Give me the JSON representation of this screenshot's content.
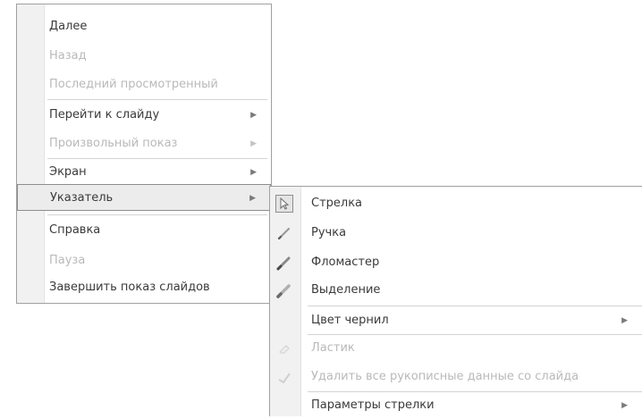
{
  "main_menu": {
    "items": [
      {
        "label": "Далее",
        "disabled": false
      },
      {
        "label": "Назад",
        "disabled": true
      },
      {
        "label": "Последний просмотренный",
        "disabled": true
      },
      {
        "label": "Перейти к слайду",
        "disabled": false,
        "submenu": true
      },
      {
        "label": "Произвольный показ",
        "disabled": true,
        "submenu": true
      },
      {
        "label": "Экран",
        "disabled": false,
        "submenu": true
      },
      {
        "label": "Указатель",
        "disabled": false,
        "submenu": true,
        "highlighted": true
      },
      {
        "label": "Справка",
        "disabled": false
      },
      {
        "label": "Пауза",
        "disabled": true
      },
      {
        "label": "Завершить показ слайдов",
        "disabled": false
      }
    ]
  },
  "pointer_submenu": {
    "items": [
      {
        "label": "Стрелка",
        "icon": "arrow-pointer-icon",
        "checked": true,
        "disabled": false
      },
      {
        "label": "Ручка",
        "icon": "pen-icon",
        "disabled": false
      },
      {
        "label": "Фломастер",
        "icon": "felt-tip-pen-icon",
        "disabled": false
      },
      {
        "label": "Выделение",
        "icon": "highlighter-icon",
        "disabled": false
      },
      {
        "label": "Цвет чернил",
        "disabled": false,
        "submenu": true
      },
      {
        "label": "Ластик",
        "icon": "eraser-icon",
        "disabled": true
      },
      {
        "label": "Удалить все рукописные данные со слайда",
        "icon": "erase-all-icon",
        "disabled": true
      },
      {
        "label": "Параметры стрелки",
        "disabled": false,
        "submenu": true
      }
    ]
  },
  "colors": {
    "menu_border": "#a0a0a0",
    "gutter": "#f1f1f1",
    "highlight": "#ececec",
    "text": "#3a3a3a",
    "disabled_text": "#b9b9b9"
  }
}
